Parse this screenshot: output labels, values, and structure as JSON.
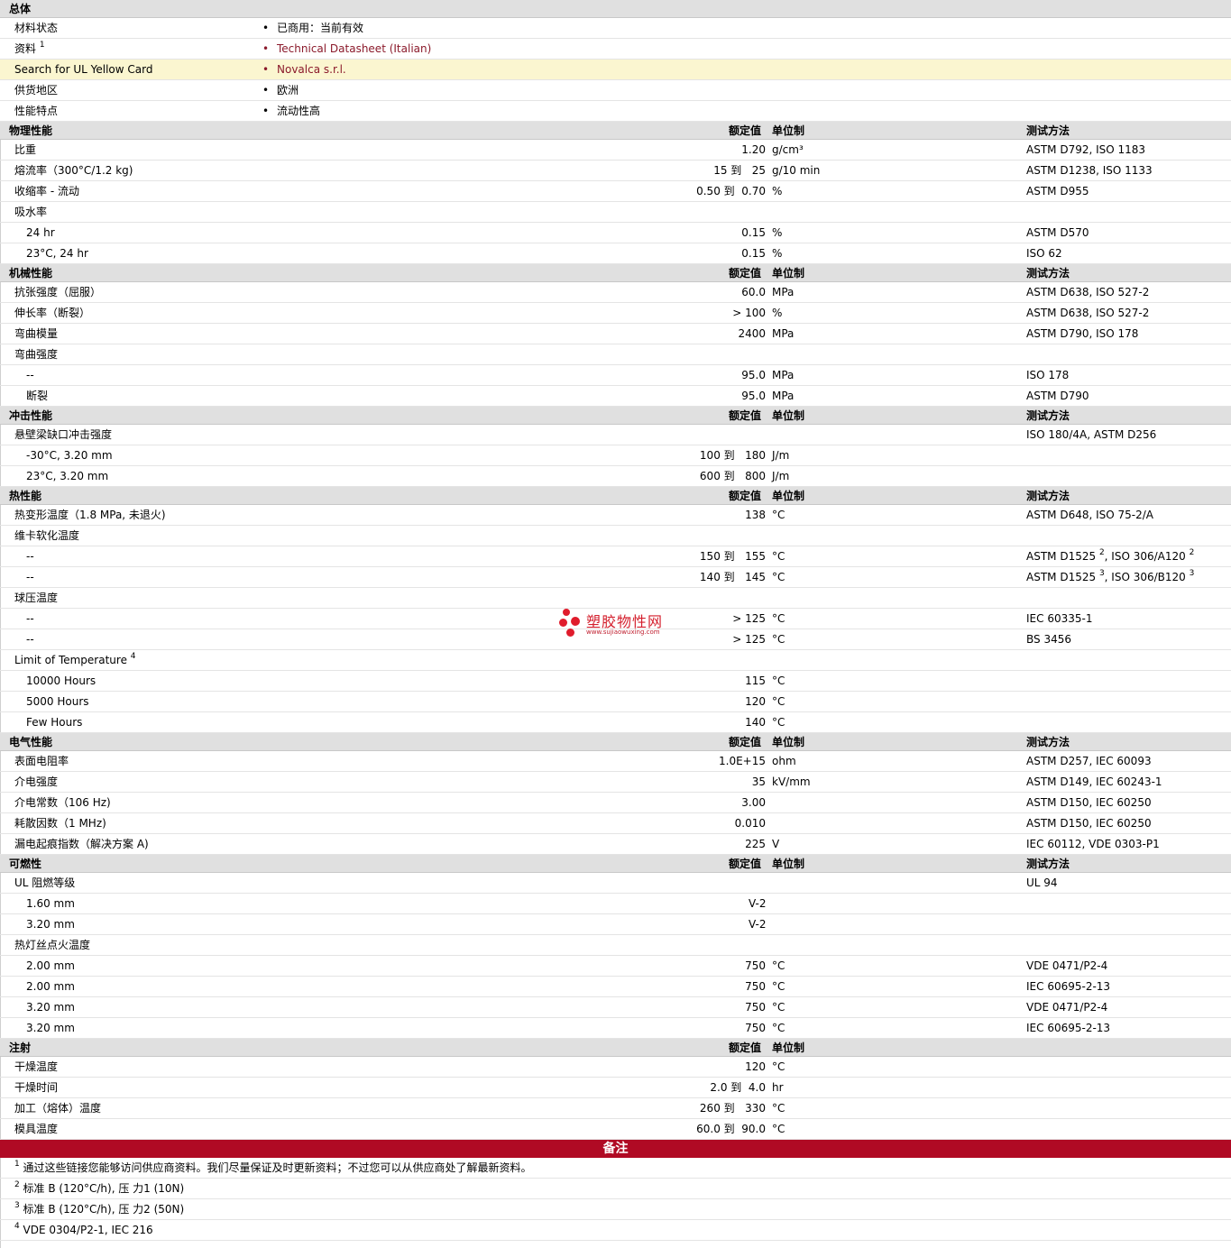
{
  "general": {
    "title": "总体",
    "rows": [
      {
        "label": "材料状态",
        "sup": "",
        "value": "已商用：当前有效",
        "link": false,
        "highlight": false
      },
      {
        "label": "资料",
        "sup": "1",
        "value": "Technical Datasheet (Italian)",
        "link": true,
        "highlight": false
      },
      {
        "label": "Search for UL Yellow Card",
        "sup": "",
        "value": "Novalca s.r.l.",
        "link": true,
        "highlight": true
      },
      {
        "label": "供货地区",
        "sup": "",
        "value": "欧洲",
        "link": false,
        "highlight": false
      },
      {
        "label": "性能特点",
        "sup": "",
        "value": "流动性高",
        "link": false,
        "highlight": false
      }
    ]
  },
  "col_headers": {
    "value": "额定值",
    "unit": "单位制",
    "method": "测试方法"
  },
  "sections": [
    {
      "title": "物理性能",
      "show_method_header": true,
      "rows": [
        {
          "label": "比重",
          "sub": false,
          "value": "1.20",
          "unit": "g/cm³",
          "method": "ASTM D792, ISO 1183"
        },
        {
          "label": "熔流率（300°C/1.2 kg)",
          "sub": false,
          "value": "15 到   25",
          "unit": "g/10 min",
          "method": "ASTM D1238, ISO 1133"
        },
        {
          "label": "收缩率 - 流动",
          "sub": false,
          "value": "0.50 到  0.70",
          "unit": "%",
          "method": "ASTM D955"
        },
        {
          "label": "吸水率",
          "sub": false,
          "value": "",
          "unit": "",
          "method": ""
        },
        {
          "label": "24 hr",
          "sub": true,
          "value": "0.15",
          "unit": "%",
          "method": "ASTM D570"
        },
        {
          "label": "23°C, 24 hr",
          "sub": true,
          "value": "0.15",
          "unit": "%",
          "method": "ISO 62"
        }
      ]
    },
    {
      "title": "机械性能",
      "show_method_header": true,
      "rows": [
        {
          "label": "抗张强度（屈服）",
          "sub": false,
          "value": "60.0",
          "unit": "MPa",
          "method": "ASTM D638, ISO 527-2"
        },
        {
          "label": "伸长率（断裂）",
          "sub": false,
          "value": "> 100",
          "unit": "%",
          "method": "ASTM D638, ISO 527-2"
        },
        {
          "label": "弯曲模量",
          "sub": false,
          "value": "2400",
          "unit": "MPa",
          "method": "ASTM D790, ISO 178"
        },
        {
          "label": "弯曲强度",
          "sub": false,
          "value": "",
          "unit": "",
          "method": ""
        },
        {
          "label": "--",
          "sub": true,
          "value": "95.0",
          "unit": "MPa",
          "method": "ISO 178"
        },
        {
          "label": "断裂",
          "sub": true,
          "value": "95.0",
          "unit": "MPa",
          "method": "ASTM D790"
        }
      ]
    },
    {
      "title": "冲击性能",
      "show_method_header": true,
      "rows": [
        {
          "label": "悬壁梁缺口冲击强度",
          "sub": false,
          "value": "",
          "unit": "",
          "method": "ISO 180/4A, ASTM D256"
        },
        {
          "label": "-30°C, 3.20 mm",
          "sub": true,
          "value": "100 到   180",
          "unit": "J/m",
          "method": ""
        },
        {
          "label": "23°C, 3.20 mm",
          "sub": true,
          "value": "600 到   800",
          "unit": "J/m",
          "method": ""
        }
      ]
    },
    {
      "title": "热性能",
      "show_method_header": true,
      "rows": [
        {
          "label": "热变形温度（1.8 MPa, 未退火)",
          "sub": false,
          "value": "138",
          "unit": "°C",
          "method": "ASTM D648, ISO 75-2/A"
        },
        {
          "label": "维卡软化温度",
          "sub": false,
          "value": "",
          "unit": "",
          "method": ""
        },
        {
          "label": "--",
          "sub": true,
          "value": "150 到   155",
          "unit": "°C",
          "method": "ASTM D1525",
          "method_sup": "2",
          "method2": ", ISO 306/A120",
          "method2_sup": "2"
        },
        {
          "label": "--",
          "sub": true,
          "value": "140 到   145",
          "unit": "°C",
          "method": "ASTM D1525",
          "method_sup": "3",
          "method2": ", ISO 306/B120",
          "method2_sup": "3"
        },
        {
          "label": "球压温度",
          "sub": false,
          "value": "",
          "unit": "",
          "method": ""
        },
        {
          "label": "--",
          "sub": true,
          "value": "> 125",
          "unit": "°C",
          "method": "IEC 60335-1"
        },
        {
          "label": "--",
          "sub": true,
          "value": "> 125",
          "unit": "°C",
          "method": "BS 3456"
        },
        {
          "label": "Limit of Temperature",
          "label_sup": "4",
          "sub": false,
          "value": "",
          "unit": "",
          "method": ""
        },
        {
          "label": "10000 Hours",
          "sub": true,
          "value": "115",
          "unit": "°C",
          "method": ""
        },
        {
          "label": "5000 Hours",
          "sub": true,
          "value": "120",
          "unit": "°C",
          "method": ""
        },
        {
          "label": "Few Hours",
          "sub": true,
          "value": "140",
          "unit": "°C",
          "method": ""
        }
      ]
    },
    {
      "title": "电气性能",
      "show_method_header": true,
      "rows": [
        {
          "label": "表面电阻率",
          "sub": false,
          "value": "1.0E+15",
          "unit": "ohm",
          "method": "ASTM D257, IEC 60093"
        },
        {
          "label": "介电强度",
          "sub": false,
          "value": "35",
          "unit": "kV/mm",
          "method": "ASTM D149, IEC 60243-1"
        },
        {
          "label": "介电常数（106 Hz)",
          "sub": false,
          "value": "3.00",
          "unit": "",
          "method": "ASTM D150, IEC 60250"
        },
        {
          "label": "耗散因数（1 MHz)",
          "sub": false,
          "value": "0.010",
          "unit": "",
          "method": "ASTM D150, IEC 60250"
        },
        {
          "label": "漏电起痕指数（解决方案 A)",
          "sub": false,
          "value": "225",
          "unit": "V",
          "method": "IEC 60112, VDE 0303-P1"
        }
      ]
    },
    {
      "title": "可燃性",
      "show_method_header": true,
      "rows": [
        {
          "label": "UL 阻燃等级",
          "sub": false,
          "value": "",
          "unit": "",
          "method": "UL 94"
        },
        {
          "label": "1.60 mm",
          "sub": true,
          "value": "V-2",
          "unit": "",
          "method": "",
          "value_left": true
        },
        {
          "label": "3.20 mm",
          "sub": true,
          "value": "V-2",
          "unit": "",
          "method": "",
          "value_left": true
        },
        {
          "label": "热灯丝点火温度",
          "sub": false,
          "value": "",
          "unit": "",
          "method": ""
        },
        {
          "label": "2.00 mm",
          "sub": true,
          "value": "750",
          "unit": "°C",
          "method": "VDE 0471/P2-4"
        },
        {
          "label": "2.00 mm",
          "sub": true,
          "value": "750",
          "unit": "°C",
          "method": "IEC 60695-2-13"
        },
        {
          "label": "3.20 mm",
          "sub": true,
          "value": "750",
          "unit": "°C",
          "method": "VDE 0471/P2-4"
        },
        {
          "label": "3.20 mm",
          "sub": true,
          "value": "750",
          "unit": "°C",
          "method": "IEC 60695-2-13"
        }
      ]
    },
    {
      "title": "注射",
      "show_method_header": false,
      "rows": [
        {
          "label": "干燥温度",
          "sub": false,
          "value": "120",
          "unit": "°C",
          "method": ""
        },
        {
          "label": "干燥时间",
          "sub": false,
          "value": "2.0 到  4.0",
          "unit": "hr",
          "method": ""
        },
        {
          "label": "加工（熔体）温度",
          "sub": false,
          "value": "260 到   330",
          "unit": "°C",
          "method": ""
        },
        {
          "label": "模具温度",
          "sub": false,
          "value": "60.0 到  90.0",
          "unit": "°C",
          "method": ""
        }
      ]
    }
  ],
  "notes": {
    "title": "备注",
    "items": [
      {
        "num": "1",
        "text": "通过这些链接您能够访问供应商资料。我们尽量保证及时更新资料；不过您可以从供应商处了解最新资料。"
      },
      {
        "num": "2",
        "text": "标准 B (120°C/h), 压 力1 (10N)"
      },
      {
        "num": "3",
        "text": "标准 B (120°C/h), 压 力2 (50N)"
      },
      {
        "num": "4",
        "text": "VDE 0304/P2-1, IEC 216"
      }
    ]
  },
  "watermark": {
    "brand": "塑胶物性网",
    "url": "www.sujiaowuxing.com",
    "color": "#e01c2c"
  },
  "colors": {
    "header_bg": "#e0e0e0",
    "highlight_bg": "#fbf6d0",
    "link": "#8b1a2b",
    "notes_bar": "#b00a24"
  }
}
